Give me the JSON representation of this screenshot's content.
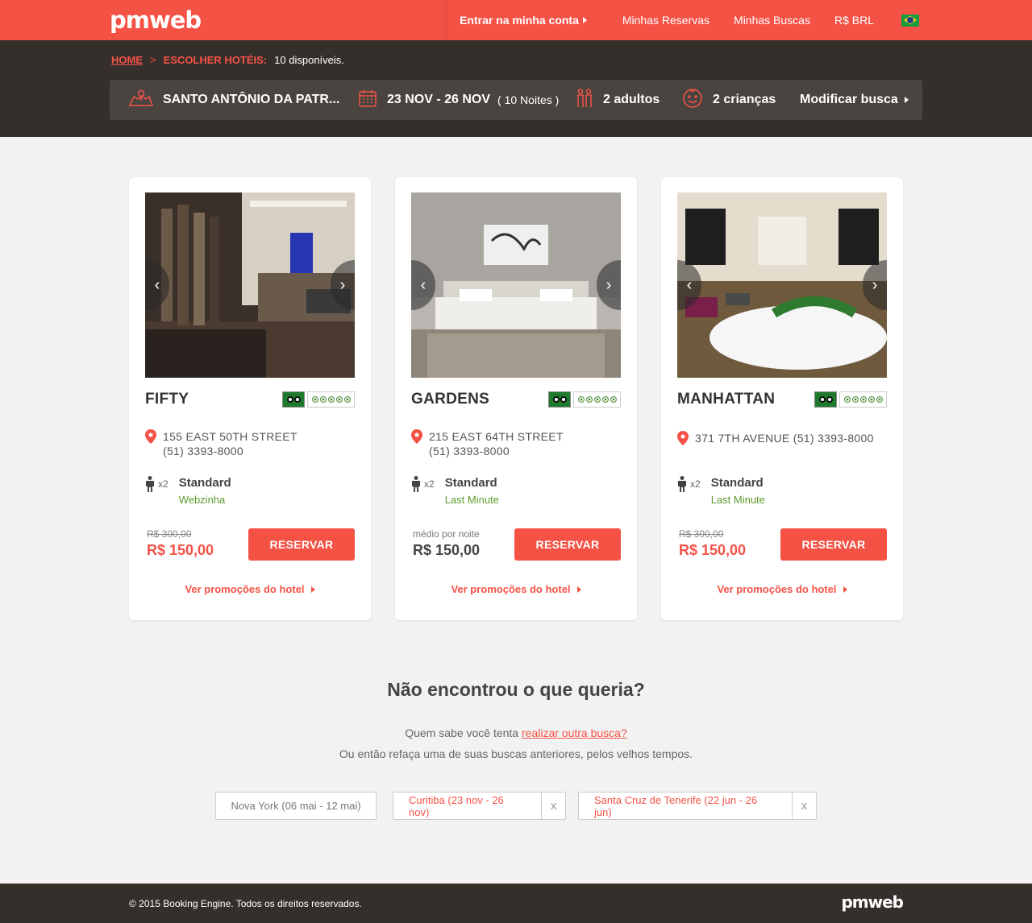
{
  "brand": {
    "logo": "pmweb",
    "accent": "#f55246",
    "dark": "#352f2c"
  },
  "topnav": {
    "login": "Entrar na minha conta",
    "reservations": "Minhas Reservas",
    "searches": "Minhas Buscas",
    "currency": "R$ BRL",
    "flag": "brazil-flag-icon"
  },
  "breadcrumb": {
    "home": "HOME",
    "sep": ">",
    "current": "ESCOLHER HOTÉIS:",
    "available": "10 disponíveis."
  },
  "search": {
    "destination": "SANTO ANTÔNIO DA PATR...",
    "dates": "23 NOV - 26 NOV",
    "nights": "( 10 Noites )",
    "adults": "2 adultos",
    "children": "2 crianças",
    "modify": "Modificar busca"
  },
  "hotels": [
    {
      "name": "FIFTY",
      "address": "155 EAST 50TH STREET",
      "phone": "(51) 3393-8000",
      "guests": "x2",
      "room": "Standard",
      "rate": "Webzinha",
      "old_price": "R$ 300,00",
      "price_label": "",
      "price": "R$ 150,00",
      "button": "RESERVAR",
      "promo": "Ver promoções do hotel",
      "tripadvisor_rating": 5
    },
    {
      "name": "GARDENS",
      "address": "215 EAST 64TH STREET",
      "phone": "(51) 3393-8000",
      "guests": "x2",
      "room": "Standard",
      "rate": "Last Minute",
      "old_price": "",
      "price_label": "médio por noite",
      "price": "R$ 150,00",
      "button": "RESERVAR",
      "promo": "Ver promoções do hotel",
      "tripadvisor_rating": 5
    },
    {
      "name": "MANHATTAN",
      "address": "371 7TH AVENUE",
      "phone": "(51) 3393-8000",
      "guests": "x2",
      "room": "Standard",
      "rate": "Last Minute",
      "old_price": "R$ 300,00",
      "price_label": "",
      "price": "R$ 150,00",
      "button": "RESERVAR",
      "promo": "Ver promoções do hotel",
      "tripadvisor_rating": 5
    }
  ],
  "not_found": {
    "title": "Não encontrou o que queria?",
    "line1_prefix": "Quem sabe você tenta ",
    "line1_link": "realizar outra busca?",
    "line2": "Ou então refaça uma de suas buscas anteriores, pelos velhos tempos."
  },
  "previous_searches": [
    {
      "label": "Nova York (06 mai - 12 mai)"
    },
    {
      "label": "Curitiba (23 nov - 26 nov)",
      "remove": "x"
    },
    {
      "label": "Santa Cruz de Tenerife (22 jun - 26 jun)",
      "remove": "x"
    }
  ],
  "footer": {
    "copyright": "© 2015 Booking Engine. Todos os direitos reservados.",
    "logo": "pmweb"
  }
}
